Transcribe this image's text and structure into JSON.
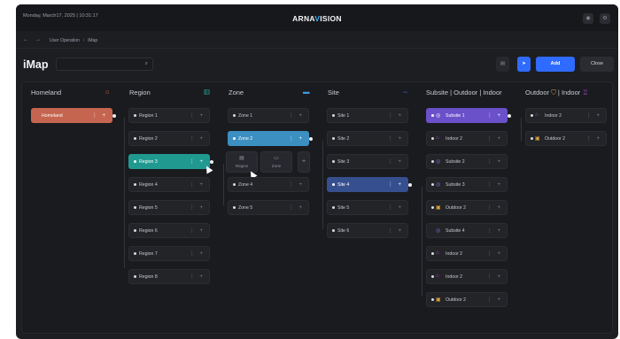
{
  "header": {
    "datetime": "Monday, March17, 2025 | 10:31:17",
    "brand_prefix": "ARNA",
    "brand_highlight": "V",
    "brand_suffix": "ISION",
    "icons": [
      "user-icon",
      "settings-icon"
    ]
  },
  "breadcrumb": {
    "back": "←",
    "forward": "→",
    "items": [
      "User Operation",
      "/",
      "iMap"
    ]
  },
  "page": {
    "title": "iMap",
    "search_icon": "⌕",
    "grid_icon": "▤",
    "send_icon": "➤",
    "add_label": "Add",
    "close_label": "Close"
  },
  "columns": {
    "homeland": {
      "title": "Homeland",
      "icon": "⌂"
    },
    "region": {
      "title": "Region",
      "icon": "▥"
    },
    "zone": {
      "title": "Zone",
      "icon": "▬"
    },
    "site": {
      "title": "Site",
      "icon": "⇔"
    },
    "subsite": {
      "title": "Subsite | Outdoor | Indoor",
      "icon": ""
    },
    "outdoor": {
      "title": "Outdoor",
      "icon_a": "⛉",
      "sep": "|",
      "title2": "Indoor",
      "icon_b": "♖"
    }
  },
  "controls": {
    "card": "⋮ +"
  },
  "homeland": [
    "Homeland"
  ],
  "regions": [
    "Region 1",
    "Region 2",
    "Region 3",
    "Region 4",
    "Region 5",
    "Region 6",
    "Region 7",
    "Region 8"
  ],
  "zones": [
    "Zone 1",
    "Zone 2",
    "Zone 4",
    "Zone 5"
  ],
  "zone_popup": {
    "region_label": "Region",
    "region_icon": "▤",
    "zone_label": "Zone",
    "zone_icon": "▭",
    "plus": "+"
  },
  "sites": [
    "Site 1",
    "Site 2",
    "Site 3",
    "Site 4",
    "Site 5",
    "Site 6"
  ],
  "subsites": [
    {
      "label": "Subsite 1",
      "glyph": "◎"
    },
    {
      "label": "Indoor 2",
      "glyph": "⌂"
    },
    {
      "label": "Subsite 2",
      "glyph": "◎"
    },
    {
      "label": "Subsite 3",
      "glyph": "◎"
    },
    {
      "label": "Outdoor 2",
      "glyph": "▣"
    },
    {
      "label": "Subsite 4",
      "glyph": "◎"
    },
    {
      "label": "Indoor 2",
      "glyph": "⌂"
    },
    {
      "label": "Indoor 2",
      "glyph": "⌂"
    },
    {
      "label": "Outdoor 2",
      "glyph": "▣"
    }
  ],
  "outdoor_indoor": [
    {
      "label": "Indoor 2",
      "glyph": "⌂"
    },
    {
      "label": "Outdoor 2",
      "glyph": "▣"
    }
  ],
  "colors": {
    "homeland": "#c6654f",
    "region_selected": "#209a91",
    "zone_selected": "#3c8fc1",
    "site_selected": "#36508f",
    "subsite_selected": "#6a50c9",
    "accent": "#2f6bff"
  }
}
